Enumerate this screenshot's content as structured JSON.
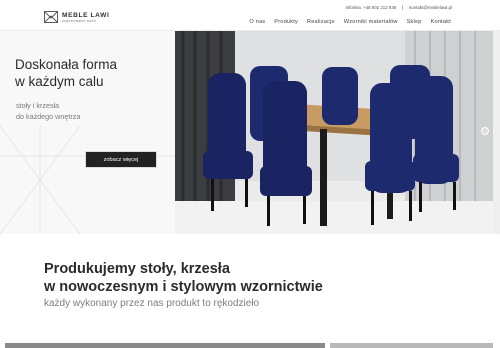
{
  "brand": {
    "name": "MEBLE LAWI",
    "tagline": "projektowanie mebli"
  },
  "contact": {
    "phone": "Infolinia: +48 502 212 936",
    "email": "kontakt@meblelawi.pl"
  },
  "nav": {
    "items": [
      "O nas",
      "Produkty",
      "Realizacje",
      "Wzorniki materiałów",
      "Sklep",
      "Kontakt"
    ]
  },
  "hero": {
    "title_line1": "Doskonała forma",
    "title_line2": "w każdym calu",
    "subtitle_line1": "stoły i krzesła",
    "subtitle_line2": "do każdego wnętrza",
    "button_label": "zobacz więcej"
  },
  "section": {
    "title_line1": "Produkujemy stoły, krzesła",
    "title_line2": "w nowoczesnym i stylowym wzornictwie",
    "subtitle": "każdy wykonany przez nas produkt to rękodzieło"
  },
  "icons": {
    "logo": "logo-icon",
    "slider": "slider-dot-icon"
  },
  "colors": {
    "chair": "#1e2a6e",
    "table_top": "#c89b63",
    "dark": "#222222"
  }
}
